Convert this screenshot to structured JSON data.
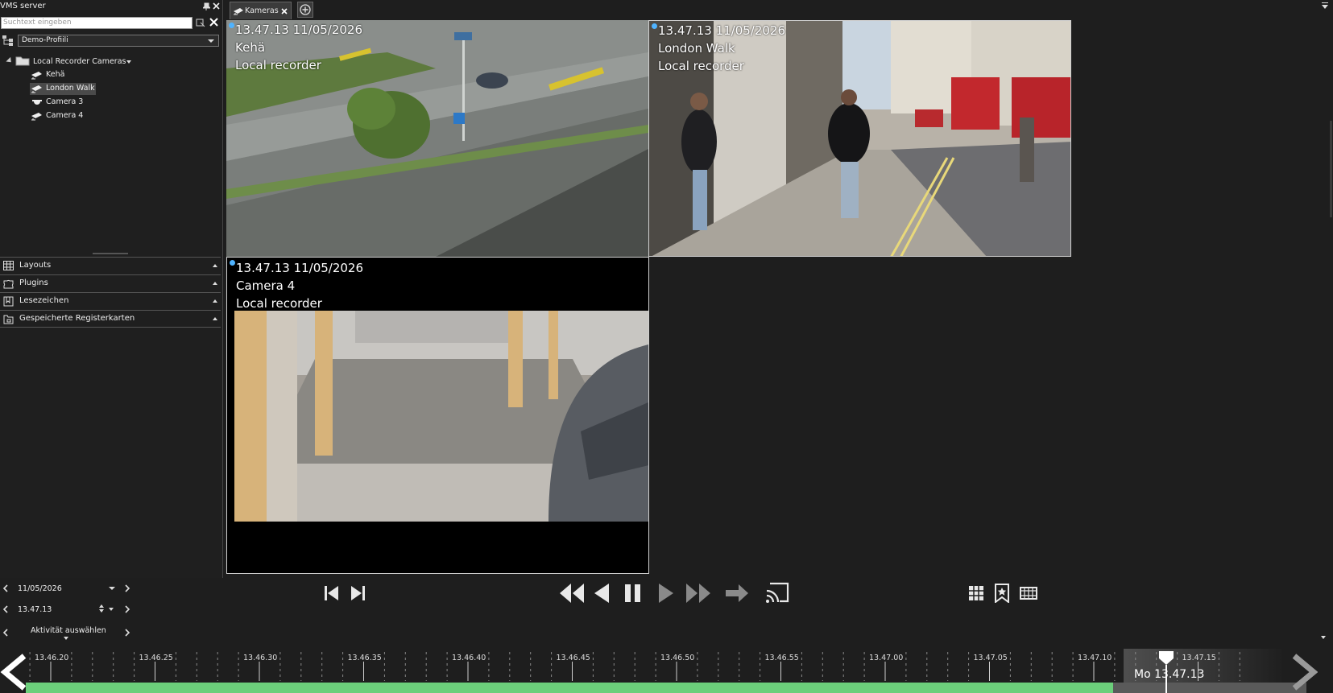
{
  "left_panel": {
    "title": "VMS server",
    "search_placeholder": "Suchtext eingeben",
    "profile": "Demo-Profiili",
    "tree": {
      "root": "Local Recorder Cameras",
      "items": [
        {
          "label": "Kehä",
          "icon": "ptz-camera-icon"
        },
        {
          "label": "London Walk",
          "icon": "ptz-camera-icon",
          "selected": true
        },
        {
          "label": "Camera 3",
          "icon": "dome-camera-icon"
        },
        {
          "label": "Camera 4",
          "icon": "ptz-camera-icon"
        }
      ]
    },
    "sections": [
      "Layouts",
      "Plugins",
      "Lesezeichen",
      "Gespeicherte Registerkarten"
    ]
  },
  "tabs": {
    "active": "Kameras"
  },
  "tiles": [
    {
      "time": "13.47.13  11/05/2026",
      "camera": "Kehä",
      "source": "Local recorder"
    },
    {
      "time": "13.47.13  11/05/2026",
      "camera": "London Walk",
      "source": "Local recorder"
    },
    {
      "time": "13.47.13  11/05/2026",
      "camera": "Camera 4",
      "source": "Local recorder"
    }
  ],
  "controls": {
    "date": "11/05/2026",
    "time": "13.47.13",
    "activity": "Aktivität auswählen"
  },
  "timeline": {
    "ticks": [
      "13.46.20",
      "13.46.25",
      "13.46.30",
      "13.46.35",
      "13.46.40",
      "13.46.45",
      "13.46.50",
      "13.46.55",
      "13.47.00",
      "13.47.05",
      "13.47.10",
      "13.47.15"
    ],
    "current": "Mo 13.47.13",
    "recorded_color": "#6ccf7b"
  }
}
